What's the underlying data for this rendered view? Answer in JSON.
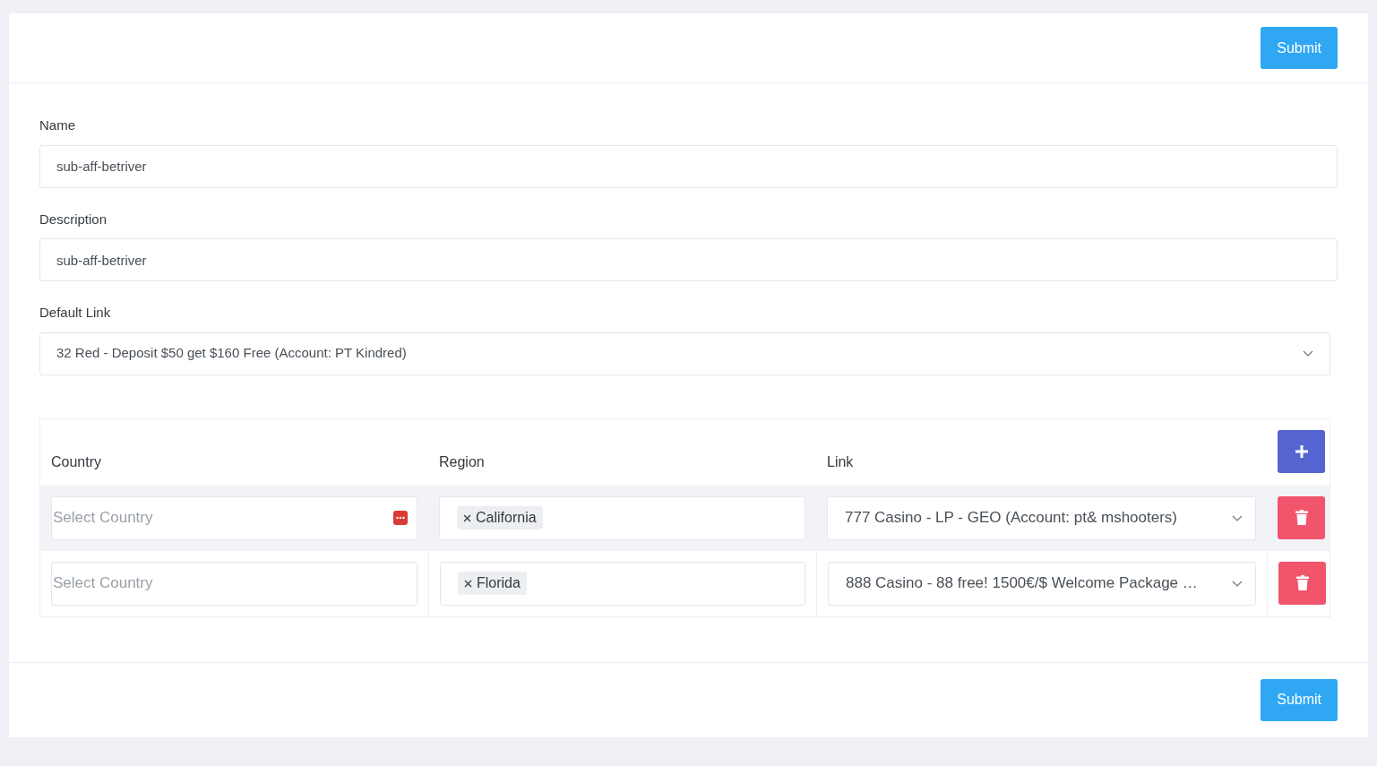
{
  "header_button": "Submit",
  "fields": [
    {
      "label": "Name",
      "value": "sub-aff-betriver"
    },
    {
      "label": "Description",
      "value": "sub-aff-betriver"
    }
  ],
  "default_link": {
    "label": "Default Link",
    "value": "32 Red - Deposit $50 get $160 Free (Account: PT Kindred)"
  },
  "table": {
    "columns": [
      "Country",
      "Region",
      "Link"
    ],
    "rows": [
      {
        "highlighted": true,
        "country_placeholder": "Select Country",
        "extension_icon": true,
        "regions": [
          "California"
        ],
        "link": "777 Casino - LP - GEO (Account: pt& mshooters)"
      },
      {
        "highlighted": false,
        "country_placeholder": "Select Country",
        "extension_icon": false,
        "regions": [
          "Florida"
        ],
        "link": "888 Casino - 88 free! 1500€/$ Welcome Package …"
      }
    ]
  },
  "footer_button": "Submit"
}
